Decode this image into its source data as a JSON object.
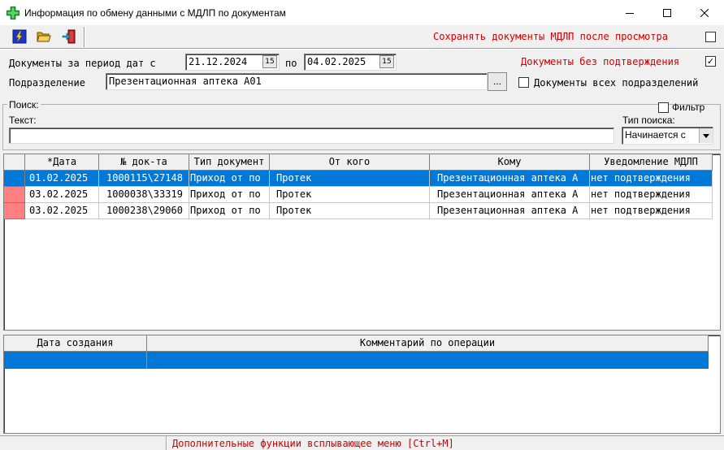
{
  "window": {
    "title": "Информация по обмену данными с МДЛП по документам",
    "icon": "green-cross-icon",
    "controls": [
      "minimize-icon",
      "maximize-icon",
      "close-icon"
    ]
  },
  "toolbar": {
    "buttons": [
      "lightning-icon",
      "open-folder-icon",
      "exit-door-icon"
    ],
    "save_docs_label": "Сохранять документы МДЛП после просмотра",
    "save_docs_checked": false
  },
  "filters": {
    "period_label": "Документы за период дат с",
    "date_from": "21.12.2024",
    "to_label": "по",
    "date_to": "04.02.2025",
    "calendar_glyph": "15",
    "unconfirmed_label": "Документы без подтверждения",
    "unconfirmed_checked": true,
    "department_label": "Подразделение",
    "department_value": "Презентационная аптека А01",
    "department_button": "...",
    "all_departments_label": "Документы всех подразделений",
    "all_departments_checked": false
  },
  "search": {
    "group_label": "Поиск:",
    "filter_label": "Фильтр",
    "filter_checked": false,
    "text_label": "Текст:",
    "text_value": "",
    "type_label": "Тип поиска:",
    "type_value": "Начинается с"
  },
  "documents": {
    "columns": [
      "*Дата",
      "№ док-та",
      "Тип документ",
      "От кого",
      "Кому",
      "Уведомление МДЛП"
    ],
    "rows": [
      {
        "date": "01.02.2025",
        "number": "1000115\\27148",
        "type": "Приход от по",
        "from": "Протек",
        "to": "Презентационная аптека А",
        "notice": "нет подтверждения",
        "selected": true
      },
      {
        "date": "03.02.2025",
        "number": "1000038\\33319",
        "type": "Приход от по",
        "from": "Протек",
        "to": "Презентационная аптека А",
        "notice": "нет подтверждения",
        "selected": false
      },
      {
        "date": "03.02.2025",
        "number": "1000238\\29060",
        "type": "Приход от по",
        "from": "Протек",
        "to": "Презентационная аптека А",
        "notice": "нет подтверждения",
        "selected": false
      }
    ],
    "marker_color": "#ff8080",
    "selection_color": "#0078d7"
  },
  "operations": {
    "columns": [
      "Дата создания",
      "Комментарий по операции"
    ]
  },
  "status": {
    "text": "Дополнительные функции всплывающее меню [Ctrl+M]"
  }
}
